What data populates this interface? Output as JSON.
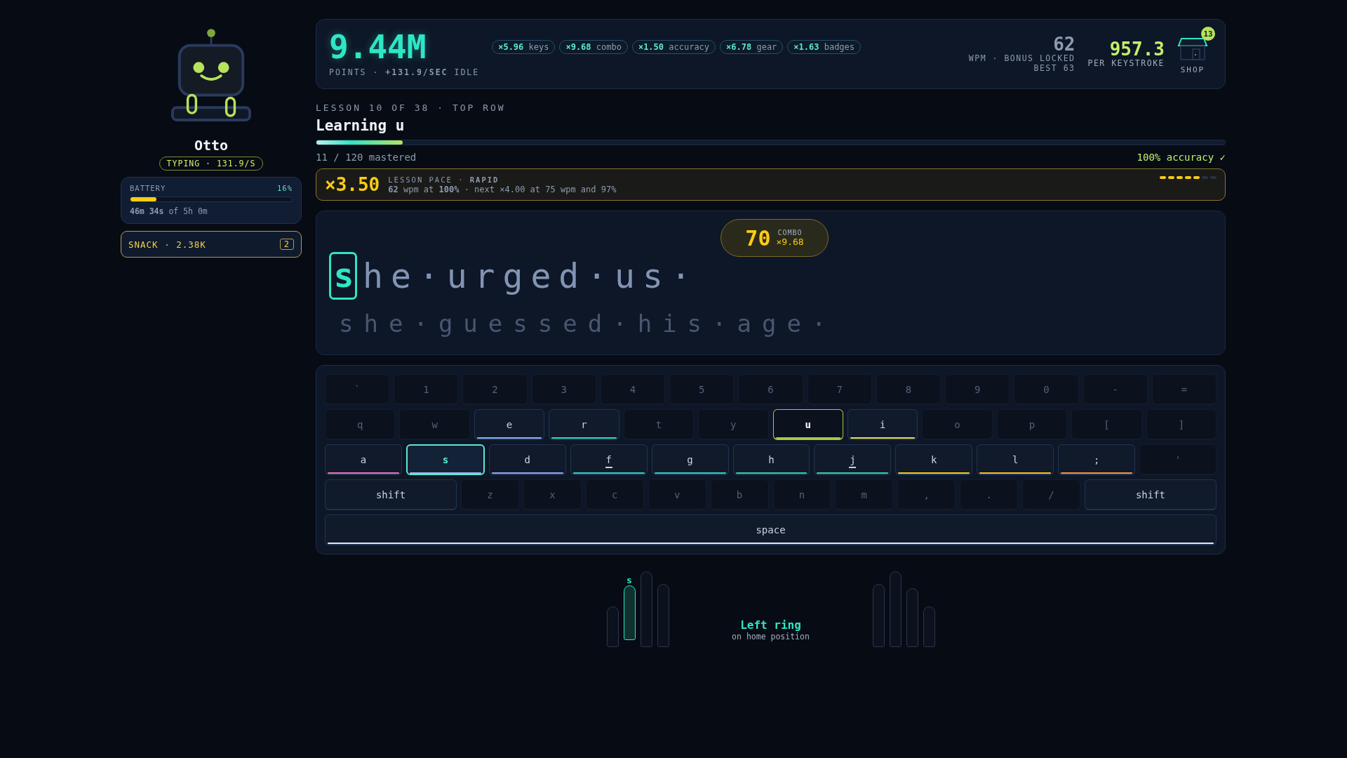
{
  "sidebar": {
    "name": "Otto",
    "status": "TYPING · 131.9/S",
    "battery": {
      "label": "BATTERY",
      "percent": "16%",
      "level": 0.16,
      "time": "**46m 34s** of 5h 0m"
    },
    "snack": {
      "label": "SNACK · 2.38K",
      "count": "2"
    }
  },
  "header": {
    "points": "9.44M",
    "points_caption": "POINTS · **+131.9/SEC** IDLE",
    "multipliers": [
      {
        "value": "×5.96",
        "label": "keys"
      },
      {
        "value": "×9.68",
        "label": "combo"
      },
      {
        "value": "×1.50",
        "label": "accuracy"
      },
      {
        "value": "×6.78",
        "label": "gear"
      },
      {
        "value": "×1.63",
        "label": "badges"
      }
    ],
    "wpm": {
      "value": "62",
      "caption": "WPM · BONUS LOCKED",
      "best": "BEST 63"
    },
    "per_keystroke": {
      "value": "957.3",
      "caption": "PER KEYSTROKE"
    },
    "shop": {
      "label": "SHOP",
      "badge": "13"
    }
  },
  "lesson": {
    "eyebrow": "LESSON 10 OF 38 · TOP ROW",
    "title": "Learning **u**",
    "level": 0.095,
    "mastered": "11 / 120 mastered",
    "accuracy": "100% accuracy ✓"
  },
  "pace": {
    "multiplier": "×3.50",
    "title": "LESSON PACE · **RAPID**",
    "detail": "**62** wpm at **100%** · next ×4.00 at 75 wpm and 97%",
    "segments": [
      {
        "on": true
      },
      {
        "on": true
      },
      {
        "on": true
      },
      {
        "on": true
      },
      {
        "on": true
      },
      {
        "on": false
      },
      {
        "on": false
      }
    ]
  },
  "typing": {
    "combo": {
      "value": "70",
      "label": "COMBO",
      "multiplier": "×9.68"
    },
    "current_char": "s",
    "remaining": "he·urged·us·",
    "next_line": "she·guessed·his·age·"
  },
  "keyboard": {
    "rows": [
      {
        "keys": [
          {
            "label": "`",
            "kind": "locked"
          },
          {
            "label": "1",
            "kind": "locked"
          },
          {
            "label": "2",
            "kind": "locked"
          },
          {
            "label": "3",
            "kind": "locked"
          },
          {
            "label": "4",
            "kind": "locked"
          },
          {
            "label": "5",
            "kind": "locked"
          },
          {
            "label": "6",
            "kind": "locked"
          },
          {
            "label": "7",
            "kind": "locked"
          },
          {
            "label": "8",
            "kind": "locked"
          },
          {
            "label": "9",
            "kind": "locked"
          },
          {
            "label": "0",
            "kind": "locked"
          },
          {
            "label": "-",
            "kind": "locked"
          },
          {
            "label": "=",
            "kind": "locked"
          }
        ]
      },
      {
        "keys": [
          {
            "label": "q",
            "kind": "locked"
          },
          {
            "label": "w",
            "kind": "locked"
          },
          {
            "label": "e",
            "kind": "open",
            "color": "#8ab4f8"
          },
          {
            "label": "r",
            "kind": "open",
            "color": "#2dd4bf"
          },
          {
            "label": "t",
            "kind": "locked"
          },
          {
            "label": "y",
            "kind": "locked"
          },
          {
            "label": "u",
            "kind": "learning",
            "color": "#a3c94a"
          },
          {
            "label": "i",
            "kind": "open",
            "color": "#e5e04a"
          },
          {
            "label": "o",
            "kind": "locked"
          },
          {
            "label": "p",
            "kind": "locked"
          },
          {
            "label": "[",
            "kind": "locked"
          },
          {
            "label": "]",
            "kind": "locked"
          }
        ]
      },
      {
        "keys": [
          {
            "label": "a",
            "kind": "open",
            "color": "#f472b6"
          },
          {
            "label": "s",
            "kind": "next",
            "color": "#a5b4fc"
          },
          {
            "label": "d",
            "kind": "open",
            "color": "#93a8f5"
          },
          {
            "label": "f",
            "kind": "open",
            "color": "#2dd4bf",
            "bump": true
          },
          {
            "label": "g",
            "kind": "open",
            "color": "#2dd4bf"
          },
          {
            "label": "h",
            "kind": "open",
            "color": "#34d399"
          },
          {
            "label": "j",
            "kind": "open",
            "color": "#34d399",
            "bump": true
          },
          {
            "label": "k",
            "kind": "open",
            "color": "#facc15"
          },
          {
            "label": "l",
            "kind": "open",
            "color": "#fbbf24"
          },
          {
            "label": ";",
            "kind": "open",
            "color": "#fb923c"
          },
          {
            "label": "'",
            "kind": "locked"
          }
        ]
      },
      {
        "keys": [
          {
            "label": "shift",
            "kind": "open"
          },
          {
            "label": "z",
            "kind": "locked"
          },
          {
            "label": "x",
            "kind": "locked"
          },
          {
            "label": "c",
            "kind": "locked"
          },
          {
            "label": "v",
            "kind": "locked"
          },
          {
            "label": "b",
            "kind": "locked"
          },
          {
            "label": "n",
            "kind": "locked"
          },
          {
            "label": "m",
            "kind": "locked"
          },
          {
            "label": ",",
            "kind": "locked"
          },
          {
            "label": ".",
            "kind": "locked"
          },
          {
            "label": "/",
            "kind": "locked"
          },
          {
            "label": "shift",
            "kind": "open"
          }
        ]
      },
      {
        "keys": [
          {
            "label": "space",
            "kind": "open",
            "color": "#e2e8f0"
          }
        ]
      }
    ]
  },
  "hands": {
    "left": [
      {
        "selected": false
      },
      {
        "selected": true,
        "key": "s"
      },
      {
        "selected": false
      },
      {
        "selected": false
      }
    ],
    "right": [
      {
        "selected": false
      },
      {
        "selected": false
      },
      {
        "selected": false
      },
      {
        "selected": false
      }
    ],
    "finger": "Left ring",
    "position": "on home position"
  }
}
